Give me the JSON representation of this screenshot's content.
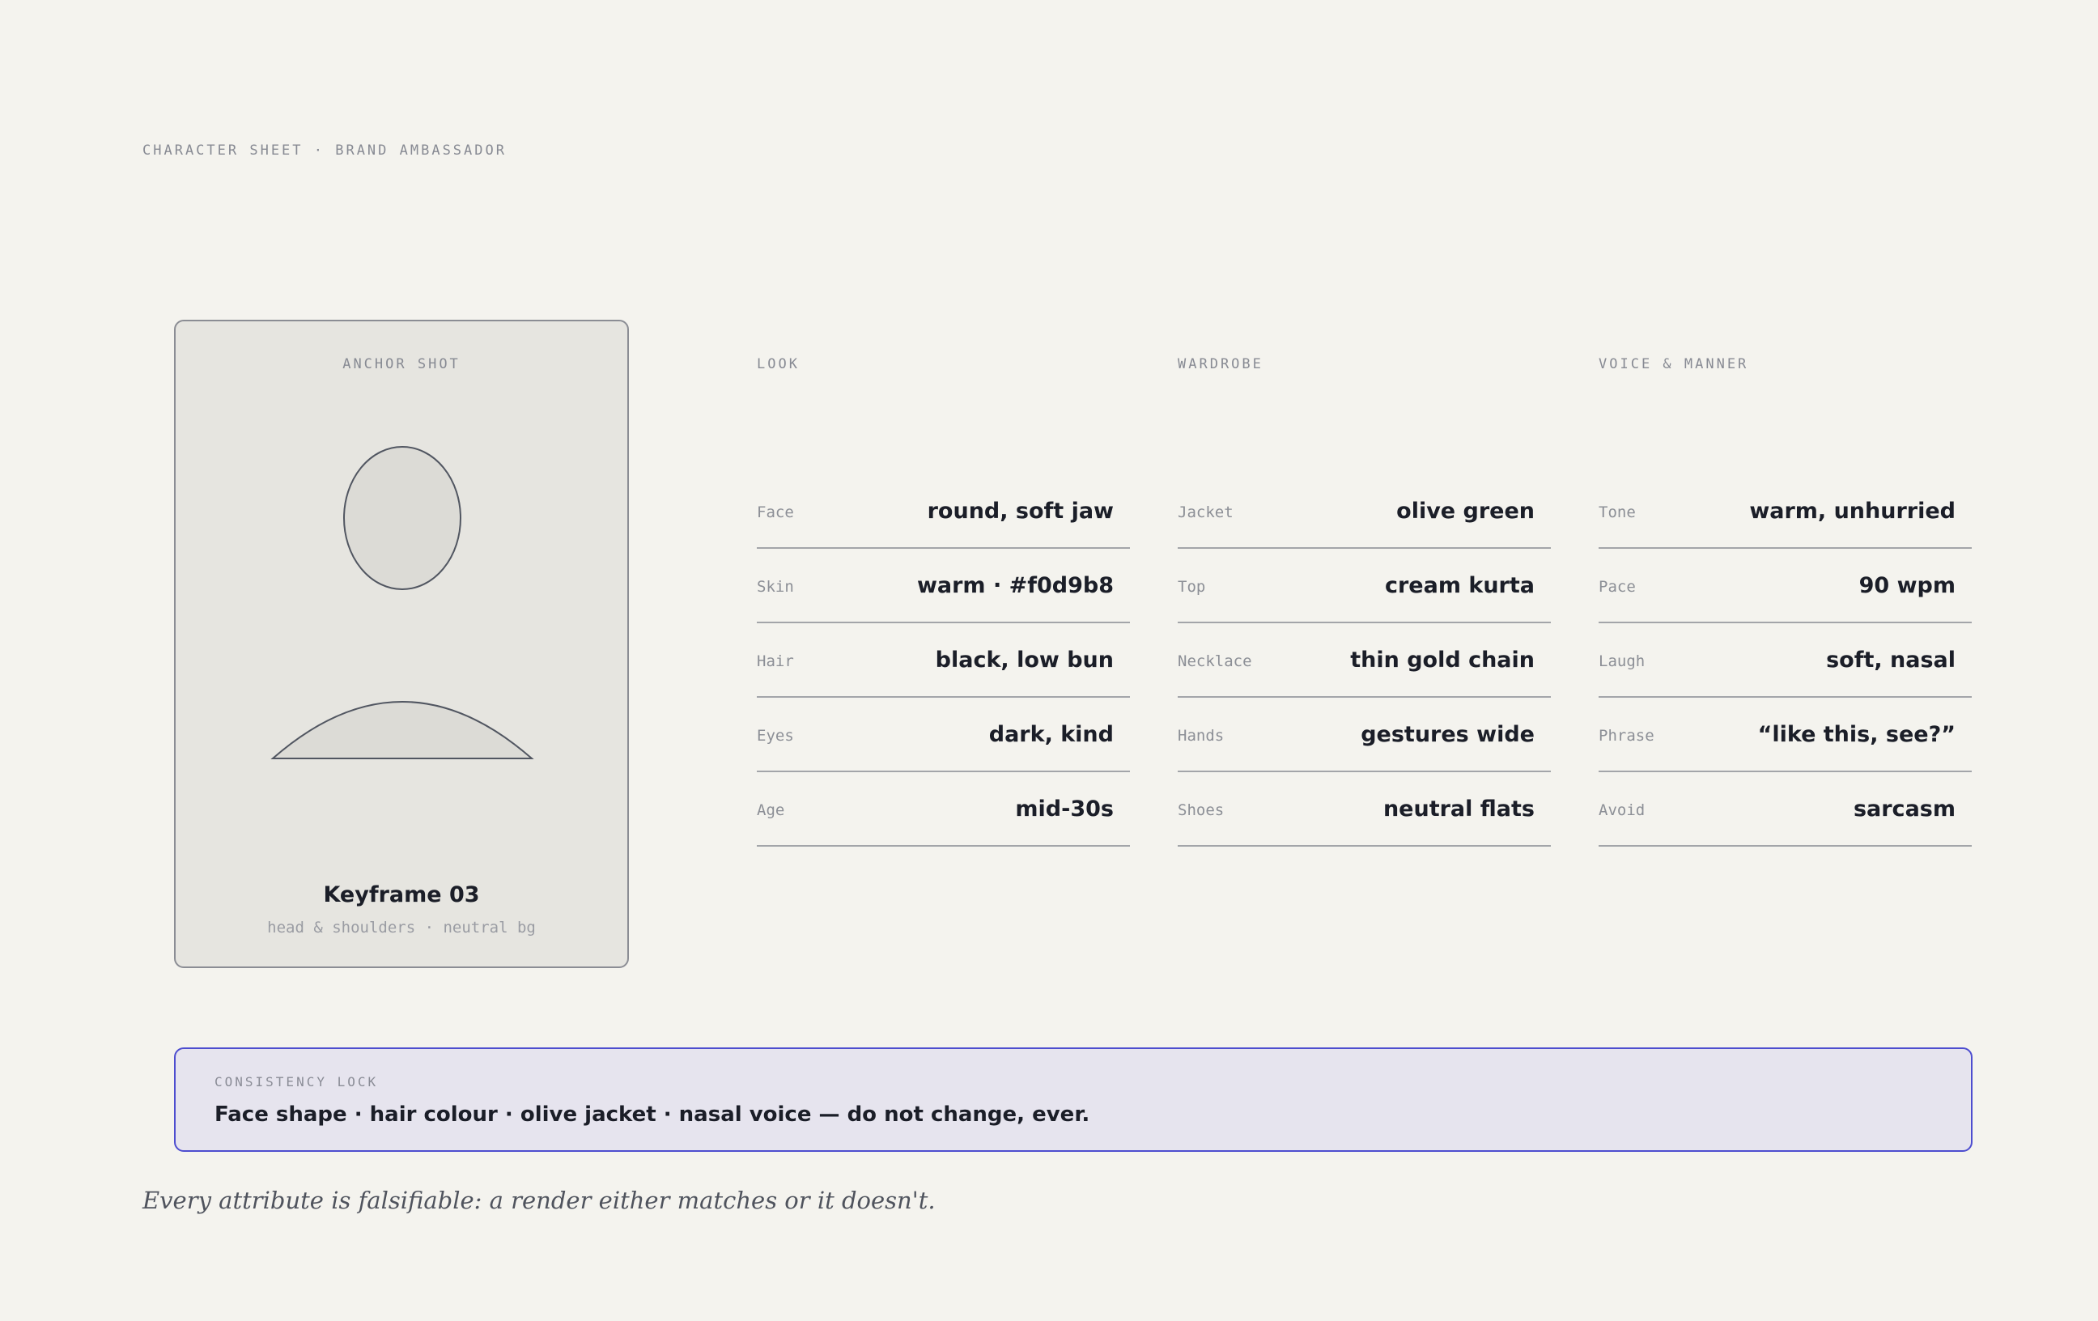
{
  "kicker": "CHARACTER SHEET · BRAND AMBASSADOR",
  "anchor": {
    "label": "ANCHOR SHOT",
    "title": "Keyframe 03",
    "subtitle": "head & shoulders · neutral bg"
  },
  "columns": [
    {
      "heading": "LOOK",
      "rows": [
        {
          "key": "Face",
          "value": "round, soft jaw"
        },
        {
          "key": "Skin",
          "value": "warm · #f0d9b8"
        },
        {
          "key": "Hair",
          "value": "black, low bun"
        },
        {
          "key": "Eyes",
          "value": "dark, kind"
        },
        {
          "key": "Age",
          "value": "mid-30s"
        }
      ]
    },
    {
      "heading": "WARDROBE",
      "rows": [
        {
          "key": "Jacket",
          "value": "olive green"
        },
        {
          "key": "Top",
          "value": "cream kurta"
        },
        {
          "key": "Necklace",
          "value": "thin gold chain"
        },
        {
          "key": "Hands",
          "value": "gestures wide"
        },
        {
          "key": "Shoes",
          "value": "neutral flats"
        }
      ]
    },
    {
      "heading": "VOICE & MANNER",
      "rows": [
        {
          "key": "Tone",
          "value": "warm, unhurried"
        },
        {
          "key": "Pace",
          "value": "90 wpm"
        },
        {
          "key": "Laugh",
          "value": "soft, nasal"
        },
        {
          "key": "Phrase",
          "value": "“like this, see?”"
        },
        {
          "key": "Avoid",
          "value": "sarcasm"
        }
      ]
    }
  ],
  "lock": {
    "label": "CONSISTENCY LOCK",
    "text": "Face shape · hair colour · olive jacket · nasal voice — do not change, ever."
  },
  "footnote": "Every attribute is falsifiable: a render either matches or it doesn't.",
  "colors": {
    "background": "#f4f3ee",
    "card": "#e6e5e0",
    "accent": "#4d4dcf",
    "lock_bg": "#e6e4ee",
    "ink": "#1b1e28"
  }
}
